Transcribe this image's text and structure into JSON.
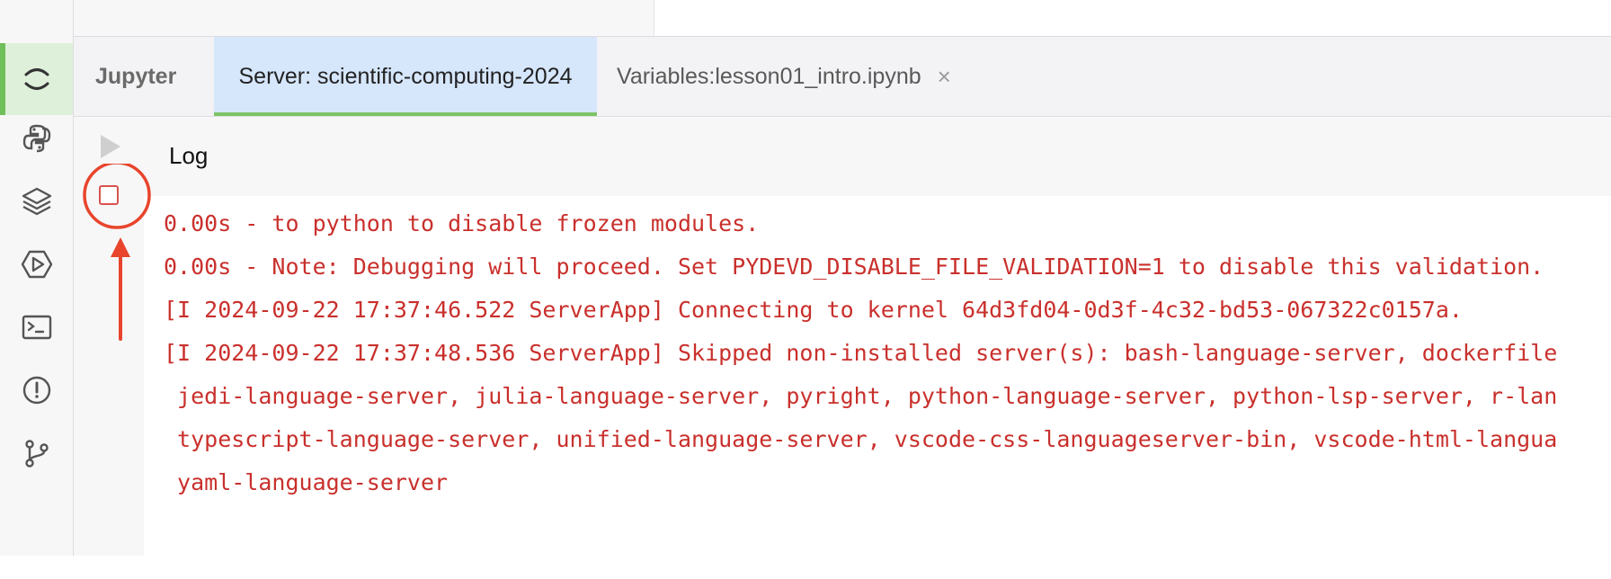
{
  "tabs": [
    {
      "label": "Jupyter"
    },
    {
      "label": "Server: scientific-computing-2024"
    },
    {
      "label": "Variables:lesson01_intro.ipynb",
      "close": "×"
    }
  ],
  "panel": {
    "title": "Log"
  },
  "log": {
    "lines": [
      "0.00s - to python to disable frozen modules.",
      "0.00s - Note: Debugging will proceed. Set PYDEVD_DISABLE_FILE_VALIDATION=1 to disable this validation.",
      "[I 2024-09-22 17:37:46.522 ServerApp] Connecting to kernel 64d3fd04-0d3f-4c32-bd53-067322c0157a.",
      "[I 2024-09-22 17:37:48.536 ServerApp] Skipped non-installed server(s): bash-language-server, dockerfile",
      " jedi-language-server, julia-language-server, pyright, python-language-server, python-lsp-server, r-lan",
      " typescript-language-server, unified-language-server, vscode-css-languageserver-bin, vscode-html-langua",
      " yaml-language-server"
    ]
  },
  "activity": [
    "jupyter-icon",
    "python-icon",
    "layers-icon",
    "run-icon",
    "terminal-icon",
    "problems-icon",
    "git-branch-icon"
  ],
  "colors": {
    "accent": "#6fbf5b",
    "log_text": "#c9302c",
    "annotation": "#e8452c",
    "active_tab": "#d6e6fb"
  }
}
